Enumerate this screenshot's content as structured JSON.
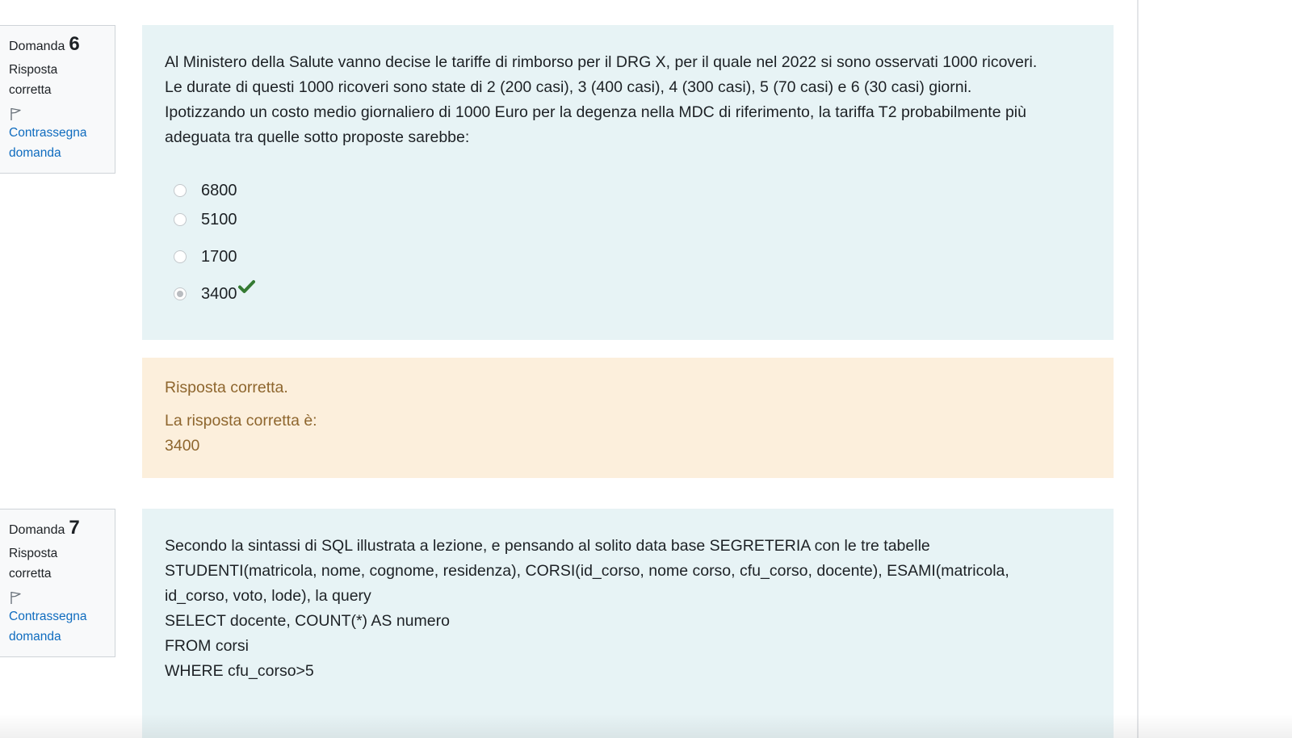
{
  "q6": {
    "info": {
      "label": "Domanda",
      "number": "6",
      "state_line1": "Risposta",
      "state_line2": "corretta",
      "flag_icon": "flag-outline-icon",
      "flag_line1": "Contrassegna",
      "flag_line2": "domanda"
    },
    "text": [
      "Al Ministero della Salute vanno decise le tariffe di rimborso per il DRG X, per il quale nel 2022 si sono osservati 1000 ricoveri.",
      "Le durate di questi 1000 ricoveri sono state di 2 (200 casi), 3 (400 casi), 4 (300 casi), 5 (70 casi) e 6 (30 casi) giorni.",
      "Ipotizzando un costo medio giornaliero di 1000 Euro per la degenza nella MDC di riferimento, la tariffa T2 probabilmente più",
      "adeguata tra quelle sotto proposte sarebbe:"
    ],
    "options": [
      {
        "label": "6800",
        "selected": false
      },
      {
        "label": "5100",
        "selected": false
      },
      {
        "label": "1700",
        "selected": false
      },
      {
        "label": "3400",
        "selected": true,
        "correct_icon": "checkmark-icon",
        "correct_color": "#357a32"
      }
    ],
    "feedback": {
      "status": "Risposta corretta.",
      "right_answer_label": "La risposta corretta è:",
      "right_answer_value": "3400"
    }
  },
  "q7": {
    "info": {
      "label": "Domanda",
      "number": "7",
      "state_line1": "Risposta",
      "state_line2": "corretta",
      "flag_icon": "flag-outline-icon",
      "flag_line1": "Contrassegna",
      "flag_line2": "domanda"
    },
    "text": [
      "Secondo la sintassi di SQL illustrata a lezione, e pensando al solito data base SEGRETERIA con le tre tabelle",
      "STUDENTI(matricola, nome, cognome, residenza), CORSI(id_corso, nome corso, cfu_corso, docente), ESAMI(matricola,",
      "id_corso, voto, lode), la query"
    ],
    "sql": [
      "SELECT docente, COUNT(*) AS numero",
      "FROM corsi",
      "WHERE cfu_corso>5"
    ]
  },
  "colors": {
    "formulation_bg": "#e7f3f5",
    "feedback_bg": "#fcefdc",
    "feedback_text": "#8e662e",
    "link": "#0f6cbf"
  }
}
